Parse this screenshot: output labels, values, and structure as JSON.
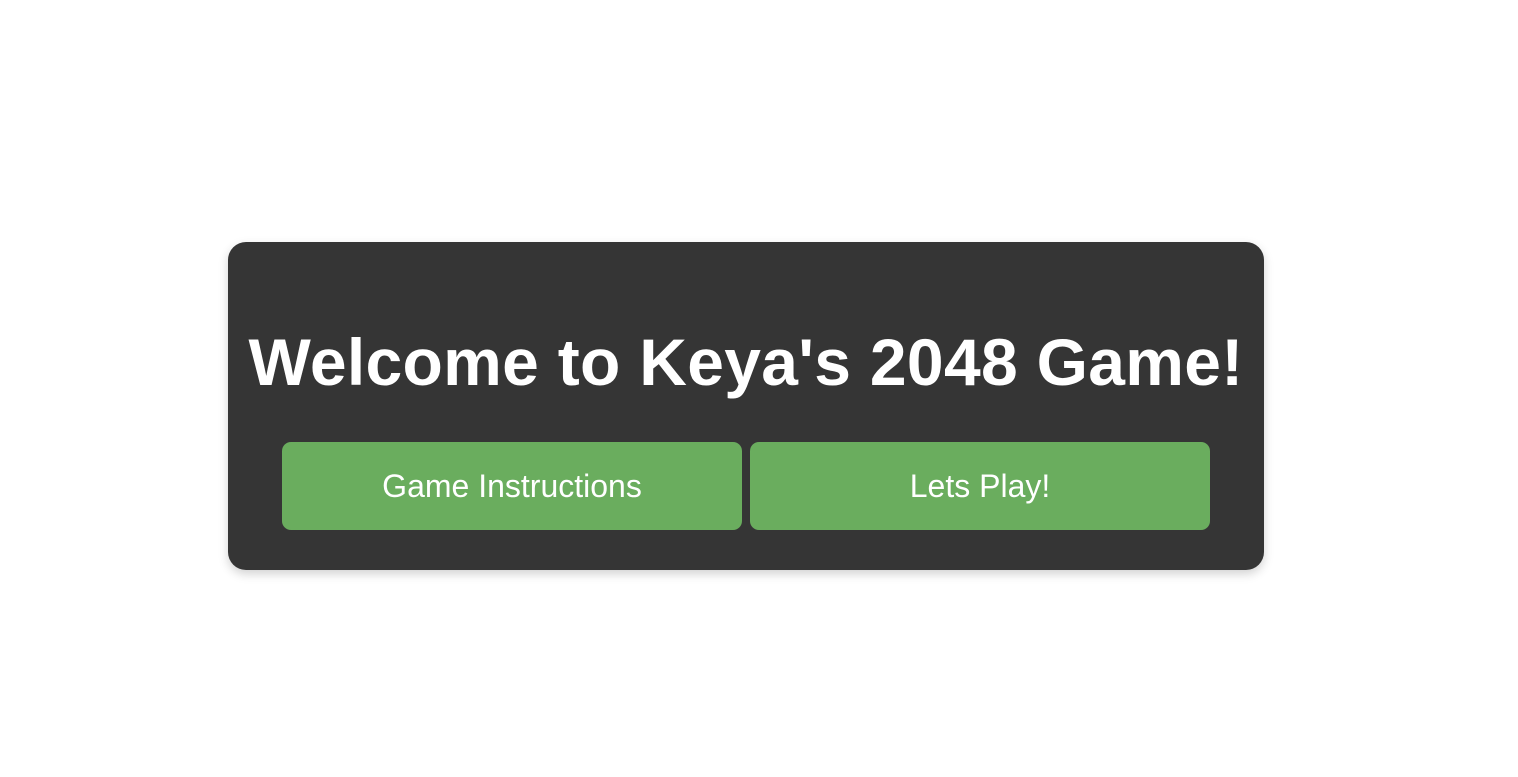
{
  "colors": {
    "page_background": "#ffffff",
    "card_background": "#353535",
    "button_background": "#6aad5e",
    "text": "#ffffff"
  },
  "welcome": {
    "title": "Welcome to Keya's 2048 Game!",
    "buttons": {
      "instructions_label": "Game Instructions",
      "play_label": "Lets Play!"
    }
  }
}
